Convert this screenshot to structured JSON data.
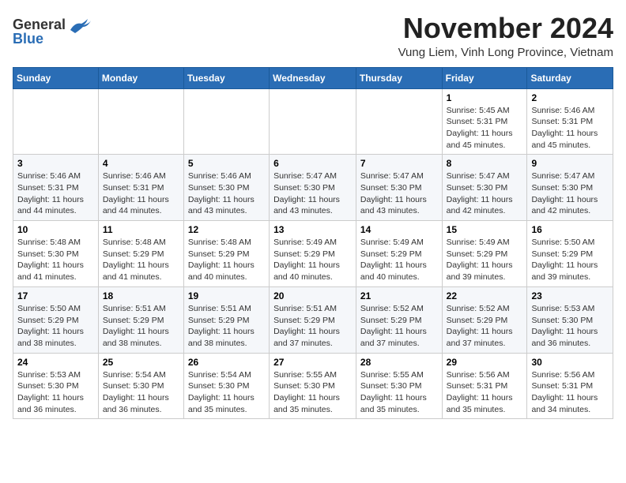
{
  "header": {
    "logo_general": "General",
    "logo_blue": "Blue",
    "month_title": "November 2024",
    "location": "Vung Liem, Vinh Long Province, Vietnam"
  },
  "days_of_week": [
    "Sunday",
    "Monday",
    "Tuesday",
    "Wednesday",
    "Thursday",
    "Friday",
    "Saturday"
  ],
  "weeks": [
    [
      {
        "day": "",
        "info": ""
      },
      {
        "day": "",
        "info": ""
      },
      {
        "day": "",
        "info": ""
      },
      {
        "day": "",
        "info": ""
      },
      {
        "day": "",
        "info": ""
      },
      {
        "day": "1",
        "info": "Sunrise: 5:45 AM\nSunset: 5:31 PM\nDaylight: 11 hours and 45 minutes."
      },
      {
        "day": "2",
        "info": "Sunrise: 5:46 AM\nSunset: 5:31 PM\nDaylight: 11 hours and 45 minutes."
      }
    ],
    [
      {
        "day": "3",
        "info": "Sunrise: 5:46 AM\nSunset: 5:31 PM\nDaylight: 11 hours and 44 minutes."
      },
      {
        "day": "4",
        "info": "Sunrise: 5:46 AM\nSunset: 5:31 PM\nDaylight: 11 hours and 44 minutes."
      },
      {
        "day": "5",
        "info": "Sunrise: 5:46 AM\nSunset: 5:30 PM\nDaylight: 11 hours and 43 minutes."
      },
      {
        "day": "6",
        "info": "Sunrise: 5:47 AM\nSunset: 5:30 PM\nDaylight: 11 hours and 43 minutes."
      },
      {
        "day": "7",
        "info": "Sunrise: 5:47 AM\nSunset: 5:30 PM\nDaylight: 11 hours and 43 minutes."
      },
      {
        "day": "8",
        "info": "Sunrise: 5:47 AM\nSunset: 5:30 PM\nDaylight: 11 hours and 42 minutes."
      },
      {
        "day": "9",
        "info": "Sunrise: 5:47 AM\nSunset: 5:30 PM\nDaylight: 11 hours and 42 minutes."
      }
    ],
    [
      {
        "day": "10",
        "info": "Sunrise: 5:48 AM\nSunset: 5:30 PM\nDaylight: 11 hours and 41 minutes."
      },
      {
        "day": "11",
        "info": "Sunrise: 5:48 AM\nSunset: 5:29 PM\nDaylight: 11 hours and 41 minutes."
      },
      {
        "day": "12",
        "info": "Sunrise: 5:48 AM\nSunset: 5:29 PM\nDaylight: 11 hours and 40 minutes."
      },
      {
        "day": "13",
        "info": "Sunrise: 5:49 AM\nSunset: 5:29 PM\nDaylight: 11 hours and 40 minutes."
      },
      {
        "day": "14",
        "info": "Sunrise: 5:49 AM\nSunset: 5:29 PM\nDaylight: 11 hours and 40 minutes."
      },
      {
        "day": "15",
        "info": "Sunrise: 5:49 AM\nSunset: 5:29 PM\nDaylight: 11 hours and 39 minutes."
      },
      {
        "day": "16",
        "info": "Sunrise: 5:50 AM\nSunset: 5:29 PM\nDaylight: 11 hours and 39 minutes."
      }
    ],
    [
      {
        "day": "17",
        "info": "Sunrise: 5:50 AM\nSunset: 5:29 PM\nDaylight: 11 hours and 38 minutes."
      },
      {
        "day": "18",
        "info": "Sunrise: 5:51 AM\nSunset: 5:29 PM\nDaylight: 11 hours and 38 minutes."
      },
      {
        "day": "19",
        "info": "Sunrise: 5:51 AM\nSunset: 5:29 PM\nDaylight: 11 hours and 38 minutes."
      },
      {
        "day": "20",
        "info": "Sunrise: 5:51 AM\nSunset: 5:29 PM\nDaylight: 11 hours and 37 minutes."
      },
      {
        "day": "21",
        "info": "Sunrise: 5:52 AM\nSunset: 5:29 PM\nDaylight: 11 hours and 37 minutes."
      },
      {
        "day": "22",
        "info": "Sunrise: 5:52 AM\nSunset: 5:29 PM\nDaylight: 11 hours and 37 minutes."
      },
      {
        "day": "23",
        "info": "Sunrise: 5:53 AM\nSunset: 5:30 PM\nDaylight: 11 hours and 36 minutes."
      }
    ],
    [
      {
        "day": "24",
        "info": "Sunrise: 5:53 AM\nSunset: 5:30 PM\nDaylight: 11 hours and 36 minutes."
      },
      {
        "day": "25",
        "info": "Sunrise: 5:54 AM\nSunset: 5:30 PM\nDaylight: 11 hours and 36 minutes."
      },
      {
        "day": "26",
        "info": "Sunrise: 5:54 AM\nSunset: 5:30 PM\nDaylight: 11 hours and 35 minutes."
      },
      {
        "day": "27",
        "info": "Sunrise: 5:55 AM\nSunset: 5:30 PM\nDaylight: 11 hours and 35 minutes."
      },
      {
        "day": "28",
        "info": "Sunrise: 5:55 AM\nSunset: 5:30 PM\nDaylight: 11 hours and 35 minutes."
      },
      {
        "day": "29",
        "info": "Sunrise: 5:56 AM\nSunset: 5:31 PM\nDaylight: 11 hours and 35 minutes."
      },
      {
        "day": "30",
        "info": "Sunrise: 5:56 AM\nSunset: 5:31 PM\nDaylight: 11 hours and 34 minutes."
      }
    ]
  ]
}
